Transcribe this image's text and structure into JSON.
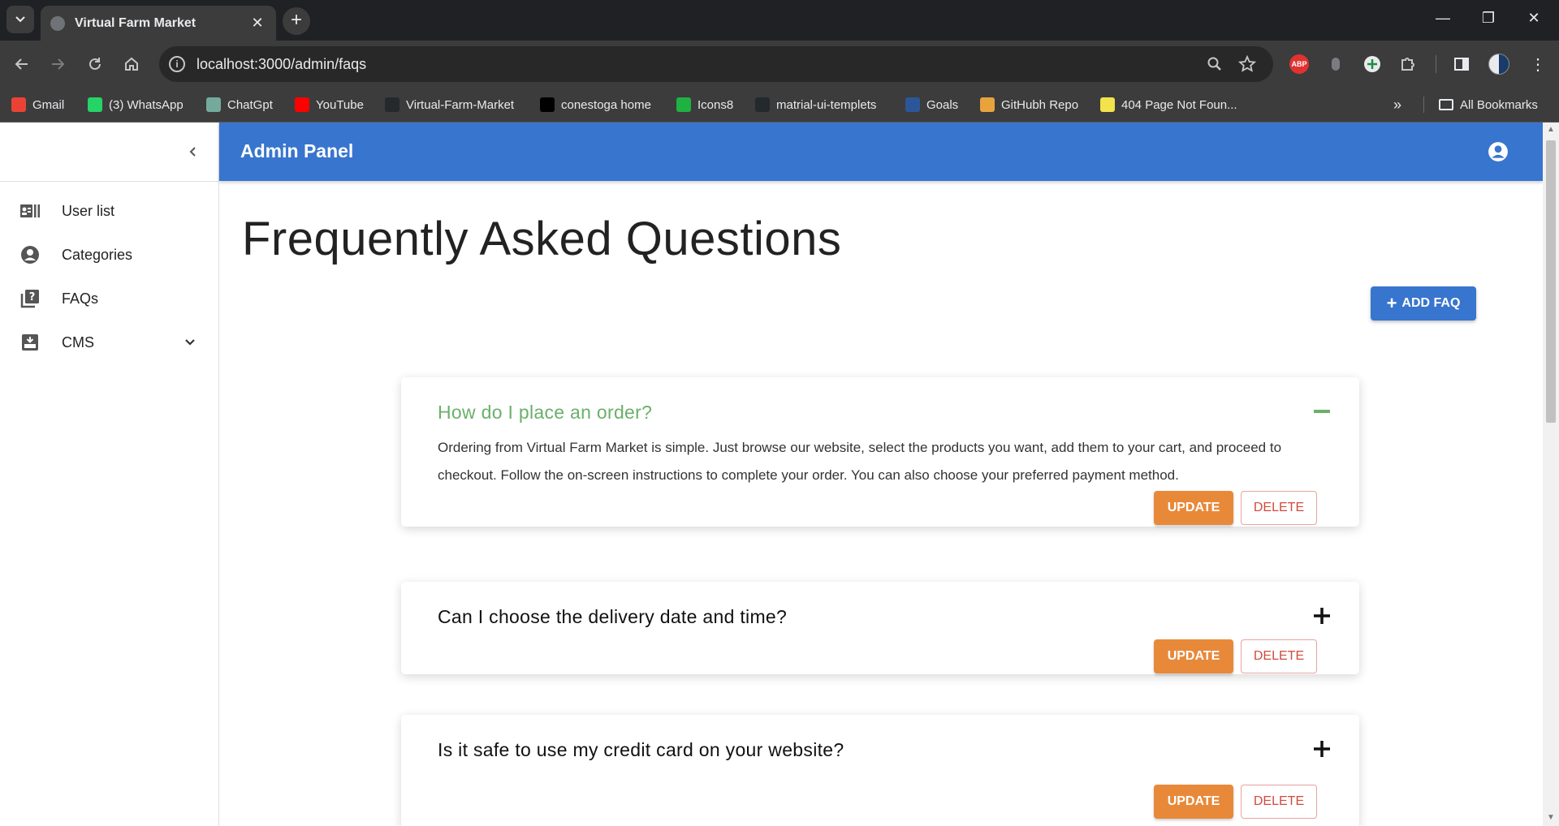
{
  "browser": {
    "tab_title": "Virtual Farm Market",
    "url": "localhost:3000/admin/faqs",
    "bookmarks": [
      {
        "label": "Gmail",
        "color": "#ea4335"
      },
      {
        "label": "(3) WhatsApp",
        "color": "#25d366"
      },
      {
        "label": "ChatGpt",
        "color": "#74aa9c"
      },
      {
        "label": "YouTube",
        "color": "#ff0000"
      },
      {
        "label": "Virtual-Farm-Market",
        "color": "#24292e"
      },
      {
        "label": "conestoga home",
        "color": "#000000"
      },
      {
        "label": "Icons8",
        "color": "#1fb141"
      },
      {
        "label": "matrial-ui-templets",
        "color": "#24292e"
      },
      {
        "label": "Goals",
        "color": "#2b579a"
      },
      {
        "label": "GitHubh Repo",
        "color": "#e8a33d"
      },
      {
        "label": "404 Page Not Foun...",
        "color": "#f2e24c"
      }
    ],
    "all_bookmarks": "All Bookmarks",
    "ext_abp": "ABP"
  },
  "sidebar": {
    "items": [
      {
        "label": "User list",
        "icon": "contacts-icon"
      },
      {
        "label": "Categories",
        "icon": "account-circle-icon"
      },
      {
        "label": "FAQs",
        "icon": "quiz-icon"
      },
      {
        "label": "CMS",
        "icon": "inbox-icon"
      }
    ]
  },
  "appbar": {
    "title": "Admin Panel"
  },
  "main": {
    "title": "Frequently Asked Questions",
    "add_label": "ADD FAQ",
    "faqs": [
      {
        "question": "How do I place an order?",
        "answer": "Ordering from Virtual Farm Market is simple. Just browse our website, select the products you want, add them to your cart, and proceed to checkout. Follow the on-screen instructions to complete your order. You can also choose your preferred payment method.",
        "expanded": true
      },
      {
        "question": "Can I choose the delivery date and time?",
        "expanded": false
      },
      {
        "question": "Is it safe to use my credit card on your website?",
        "expanded": false
      }
    ],
    "update_label": "UPDATE",
    "delete_label": "DELETE"
  },
  "colors": {
    "appbar": "#3875ce",
    "update": "#e8893a",
    "delete": "#d24a3f",
    "open_question": "#6ab06a"
  }
}
